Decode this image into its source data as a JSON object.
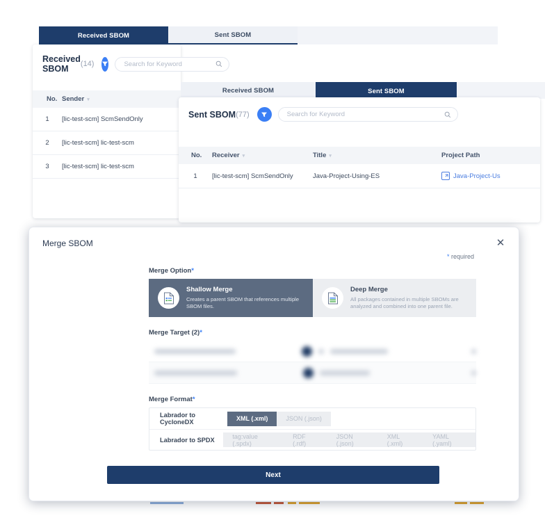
{
  "background": {
    "received_panel": {
      "tabs": [
        {
          "label": "Received SBOM",
          "active": true
        },
        {
          "label": "Sent SBOM",
          "active": false
        }
      ],
      "title": "Received SBOM",
      "count": "(14)",
      "filter_icon": "filter-icon",
      "search": {
        "placeholder": "Search for Keyword",
        "value": "",
        "icon": "search-icon"
      },
      "columns": [
        "No.",
        "Sender"
      ],
      "rows": [
        {
          "no": "1",
          "sender": "[lic-test-scm] ScmSendOnly"
        },
        {
          "no": "2",
          "sender": "[lic-test-scm] lic-test-scm"
        },
        {
          "no": "3",
          "sender": "[lic-test-scm] lic-test-scm"
        }
      ]
    },
    "sent_panel": {
      "tabs": [
        {
          "label": "Received SBOM",
          "active": false
        },
        {
          "label": "Sent SBOM",
          "active": true
        }
      ],
      "title": "Sent SBOM",
      "count": "(77)",
      "filter_icon": "filter-icon",
      "search": {
        "placeholder": "Search for Keyword",
        "value": "",
        "icon": "search-icon"
      },
      "columns": [
        "No.",
        "Receiver",
        "Title",
        "Project Path"
      ],
      "rows": [
        {
          "no": "1",
          "receiver": "[lic-test-scm] ScmSendOnly",
          "title": "Java-Project-Using-ES",
          "project_path": "Java-Project-Us",
          "path_icon": "external-link-icon"
        }
      ]
    }
  },
  "modal": {
    "title": "Merge SBOM",
    "close_icon": "close-icon",
    "required_note": "required",
    "required_star": "*",
    "merge_option": {
      "label": "Merge Option",
      "options": [
        {
          "name": "Shallow Merge",
          "desc": "Creates a parent SBOM that references multiple SBOM files.",
          "icon": "document-list-icon",
          "selected": true
        },
        {
          "name": "Deep Merge",
          "desc": "All packages contained in multiple SBOMs are analyzed and combined into one parent file.",
          "icon": "document-lines-icon",
          "selected": false
        }
      ]
    },
    "merge_target": {
      "label": "Merge Target (2)",
      "row_count": 2
    },
    "merge_format": {
      "label": "Merge Format",
      "rows": [
        {
          "name": "Labrador to CycloneDX",
          "chips": [
            {
              "label": "XML (.xml)",
              "selected": true
            },
            {
              "label": "JSON (.json)",
              "selected": false
            }
          ]
        },
        {
          "name": "Labrador to SPDX",
          "chips": [
            {
              "label": "tag:value (.spdx)",
              "selected": false
            },
            {
              "label": "RDF (.rdf)",
              "selected": false
            },
            {
              "label": "JSON (.json)",
              "selected": false
            },
            {
              "label": "XML (.xml)",
              "selected": false
            },
            {
              "label": "YAML (.yaml)",
              "selected": false
            }
          ]
        }
      ]
    },
    "next_label": "Next"
  },
  "colors": {
    "navy": "#1e3d6b",
    "slate": "#5c6b81",
    "accent_blue": "#3b7ff5",
    "link_blue": "#4a7de0",
    "header_bg": "#f3f5f8"
  }
}
